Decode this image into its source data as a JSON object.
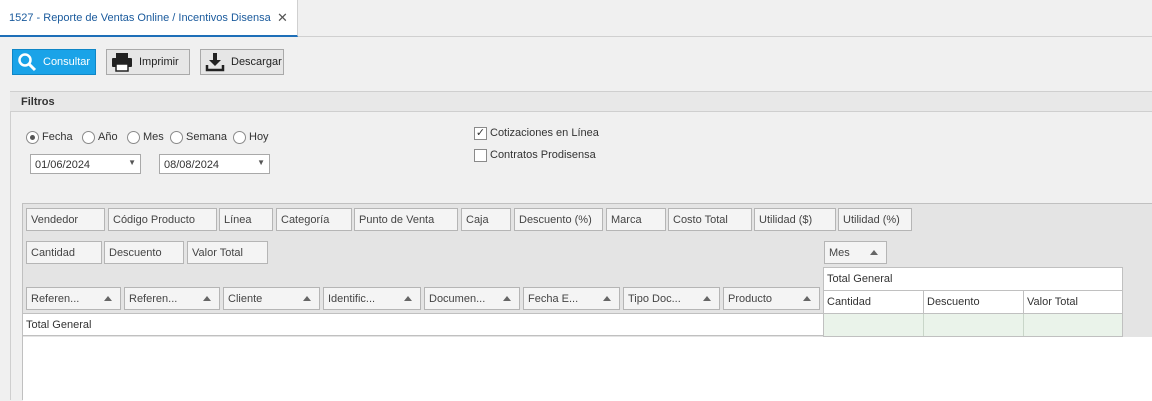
{
  "tab": {
    "title": "1527 - Reporte de Ventas Online / Incentivos Disensa",
    "close": "✕"
  },
  "toolbar": {
    "consultar": "Consultar",
    "imprimir": "Imprimir",
    "descargar": "Descargar"
  },
  "filters": {
    "title": "Filtros",
    "period_options": [
      {
        "label": "Fecha",
        "selected": true
      },
      {
        "label": "Año",
        "selected": false
      },
      {
        "label": "Mes",
        "selected": false
      },
      {
        "label": "Semana",
        "selected": false
      },
      {
        "label": "Hoy",
        "selected": false
      }
    ],
    "date_from": "01/06/2024",
    "date_to": "08/08/2024",
    "checks": [
      {
        "label": "Cotizaciones en Línea",
        "checked": true
      },
      {
        "label": "Contratos Prodisensa",
        "checked": false
      }
    ]
  },
  "pivot": {
    "filter_fields": [
      "Vendedor",
      "Código Producto",
      "Línea",
      "Categoría",
      "Punto de Venta",
      "Caja",
      "Descuento (%)",
      "Marca",
      "Costo Total",
      "Utilidad ($)",
      "Utilidad (%)"
    ],
    "data_fields": [
      "Cantidad",
      "Descuento",
      "Valor Total"
    ],
    "column_field": "Mes",
    "row_fields": [
      "Referen...",
      "Referen...",
      "Cliente",
      "Identific...",
      "Documen...",
      "Fecha E...",
      "Tipo Doc...",
      "Producto"
    ],
    "row_total_label": "Total General",
    "column_total_label": "Total General",
    "value_headers": [
      "Cantidad",
      "Descuento",
      "Valor Total"
    ]
  }
}
